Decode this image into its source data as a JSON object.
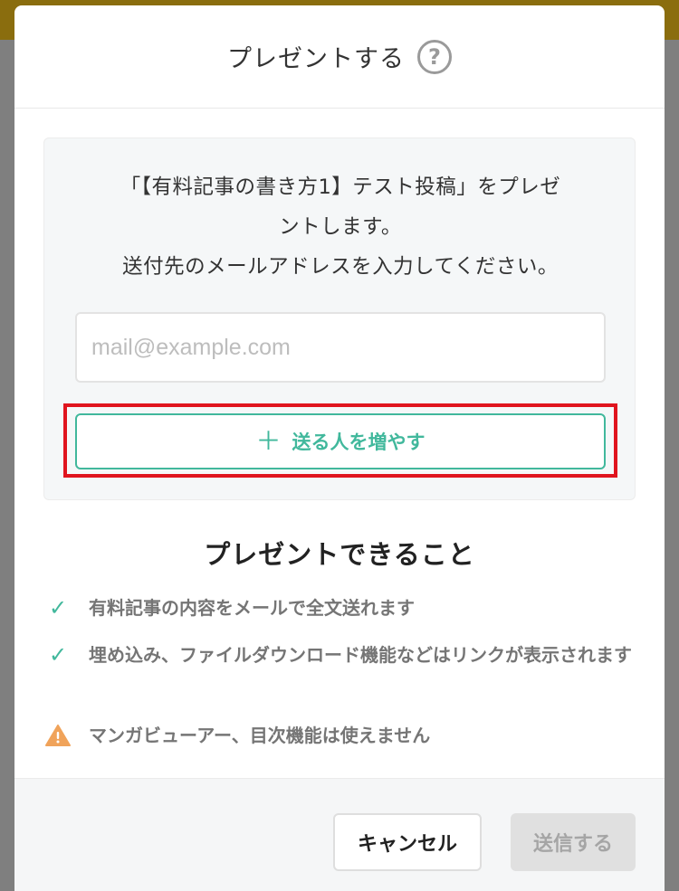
{
  "modal": {
    "title": "プレゼントする",
    "help_symbol": "?"
  },
  "panel": {
    "description_line1": "「【有料記事の書き方1】テスト投稿」をプレゼ",
    "description_line2": "ントします。",
    "description_line3": "送付先のメールアドレスを入力してください。",
    "email_placeholder": "mail@example.com",
    "email_value": "",
    "add_recipient_label": "送る人を増やす"
  },
  "features": {
    "title": "プレゼントできること",
    "items": [
      {
        "icon": "check-icon",
        "text": "有料記事の内容をメールで全文送れます"
      },
      {
        "icon": "check-icon",
        "text": "埋め込み、ファイルダウンロード機能などはリンクが表示されます"
      },
      {
        "icon": "warning-icon",
        "text": "マンガビューアー、目次機能は使えません"
      }
    ]
  },
  "footer": {
    "cancel_label": "キャンセル",
    "send_label": "送信する"
  },
  "colors": {
    "accent": "#41b89c",
    "highlight": "#e0141e",
    "warning": "#f0a35a",
    "top_bar": "#8a6d0e"
  }
}
